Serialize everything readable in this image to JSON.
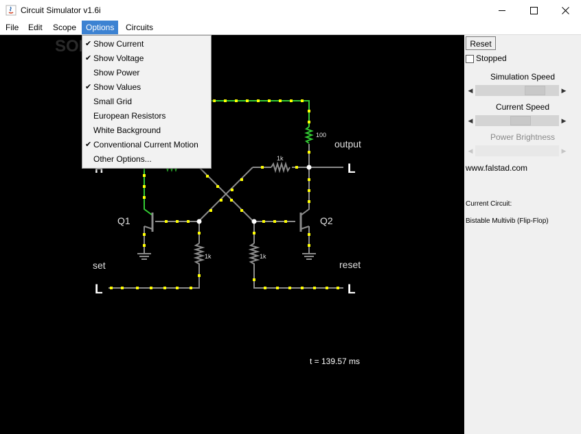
{
  "window": {
    "title": "Circuit Simulator v1.6i",
    "controls": {
      "minimize": "—",
      "maximize": "☐",
      "close": "✕"
    }
  },
  "menubar": {
    "items": [
      "File",
      "Edit",
      "Scope",
      "Options",
      "Circuits"
    ],
    "active": "Options"
  },
  "options_menu": {
    "items": [
      {
        "label": "Show Current",
        "checked": true
      },
      {
        "label": "Show Voltage",
        "checked": true
      },
      {
        "label": "Show Power",
        "checked": false
      },
      {
        "label": "Show Values",
        "checked": true
      },
      {
        "label": "Small Grid",
        "checked": false
      },
      {
        "label": "European Resistors",
        "checked": false
      },
      {
        "label": "White Background",
        "checked": false
      },
      {
        "label": "Conventional Current Motion",
        "checked": true
      },
      {
        "label": "Other Options...",
        "checked": false
      }
    ],
    "check_glyph": "✔"
  },
  "panel": {
    "reset_label": "Reset",
    "stopped_label": "Stopped",
    "stopped_checked": false,
    "sim_speed_label": "Simulation Speed",
    "sim_speed_fraction": 0.78,
    "current_speed_label": "Current Speed",
    "current_speed_fraction": 0.55,
    "power_brightness_label": "Power Brightness",
    "power_brightness_fraction": 0.5,
    "website": "www.falstad.com",
    "current_circuit_label": "Current Circuit:",
    "current_circuit_name": "Bistable Multivib (Flip-Flop)"
  },
  "circuit": {
    "labels": {
      "q1": "Q1",
      "q2": "Q2",
      "set": "set",
      "reset": "reset",
      "output": "output",
      "r_top": "100",
      "r_mid": "1k",
      "r_left": "1k",
      "r_right": "1k",
      "logic_set": "L",
      "logic_reset": "L",
      "logic_out": "L",
      "logic_h": "H"
    },
    "time_display": "t = 139.57 ms",
    "watermark": "SOFTPEDIA"
  },
  "colors": {
    "wire_gray": "#8c8c8c",
    "wire_green": "#33cc33",
    "current_dot": "#ffff00",
    "menu_highlight": "#3c82d2",
    "canvas_bg": "#000000"
  }
}
